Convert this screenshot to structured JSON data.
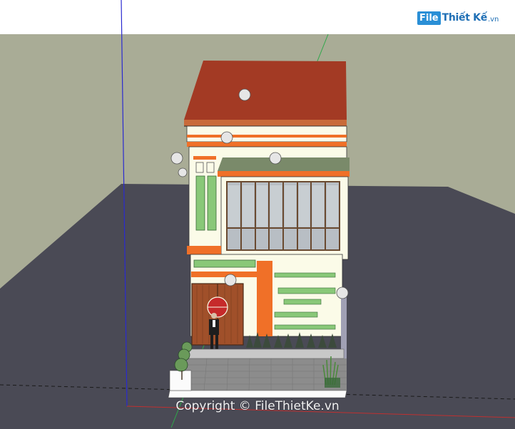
{
  "logo": {
    "box_text": "File",
    "main_text": "Thiết Kế",
    "suffix": ".vn",
    "color": "#2a8fd6"
  },
  "watermark": {
    "text": "Copyright © FileThietKe.vn"
  },
  "colors": {
    "sky": "#ffffff",
    "ground": "#a9ac96",
    "lot": "#4a4a55",
    "roof": "#a33a24",
    "wall": "#fbfbe8",
    "accent": "#f07028",
    "green_panel": "#89c878",
    "door": "#a0502a",
    "glass": "#b8bec4",
    "pavement": "#8c8c8c"
  }
}
